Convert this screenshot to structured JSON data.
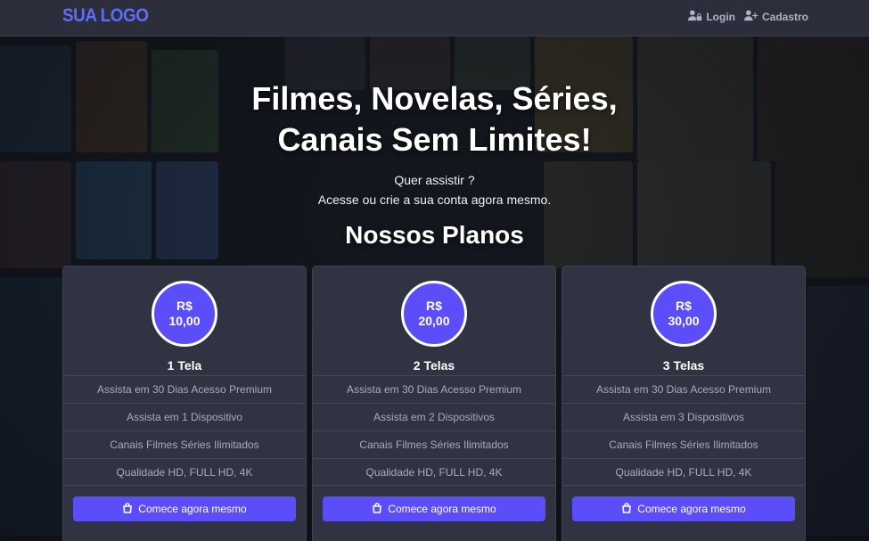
{
  "nav": {
    "logo": "SUA LOGO",
    "login_label": "Login",
    "signup_label": "Cadastro"
  },
  "hero": {
    "title_line1": "Filmes, Novelas, Séries,",
    "title_line2": "Canais Sem Limites!",
    "question": "Quer assistir ?",
    "subtitle": "Acesse ou crie a sua conta agora mesmo.",
    "plans_heading": "Nossos Planos"
  },
  "plans": [
    {
      "currency": "R$",
      "price": "10,00",
      "title": "1 Tela",
      "features": [
        "Assista em 30 Dias Acesso Premium",
        "Assista em 1 Dispositivo",
        "Canais Filmes Séries Ilimitados",
        "Qualidade HD, FULL HD, 4K"
      ],
      "cta": "Comece agora mesmo"
    },
    {
      "currency": "R$",
      "price": "20,00",
      "title": "2 Telas",
      "features": [
        "Assista em 30 Dias Acesso Premium",
        "Assista em 2 Dispositivos",
        "Canais Filmes Séries Ilimitados",
        "Qualidade HD, FULL HD, 4K"
      ],
      "cta": "Comece agora mesmo"
    },
    {
      "currency": "R$",
      "price": "30,00",
      "title": "3 Telas",
      "features": [
        "Assista em 30 Dias Acesso Premium",
        "Assista em 3 Dispositivos",
        "Canais Filmes Séries Ilimitados",
        "Qualidade HD, FULL HD, 4K"
      ],
      "cta": "Comece agora mesmo"
    }
  ],
  "colors": {
    "accent": "#5b4df7",
    "logo": "#5c6cff",
    "card_bg": "#303341",
    "nav_bg": "#2c2f3b"
  },
  "icons": {
    "login": "user-lock-icon",
    "signup": "user-plus-icon",
    "cta": "shopping-bag-icon"
  }
}
